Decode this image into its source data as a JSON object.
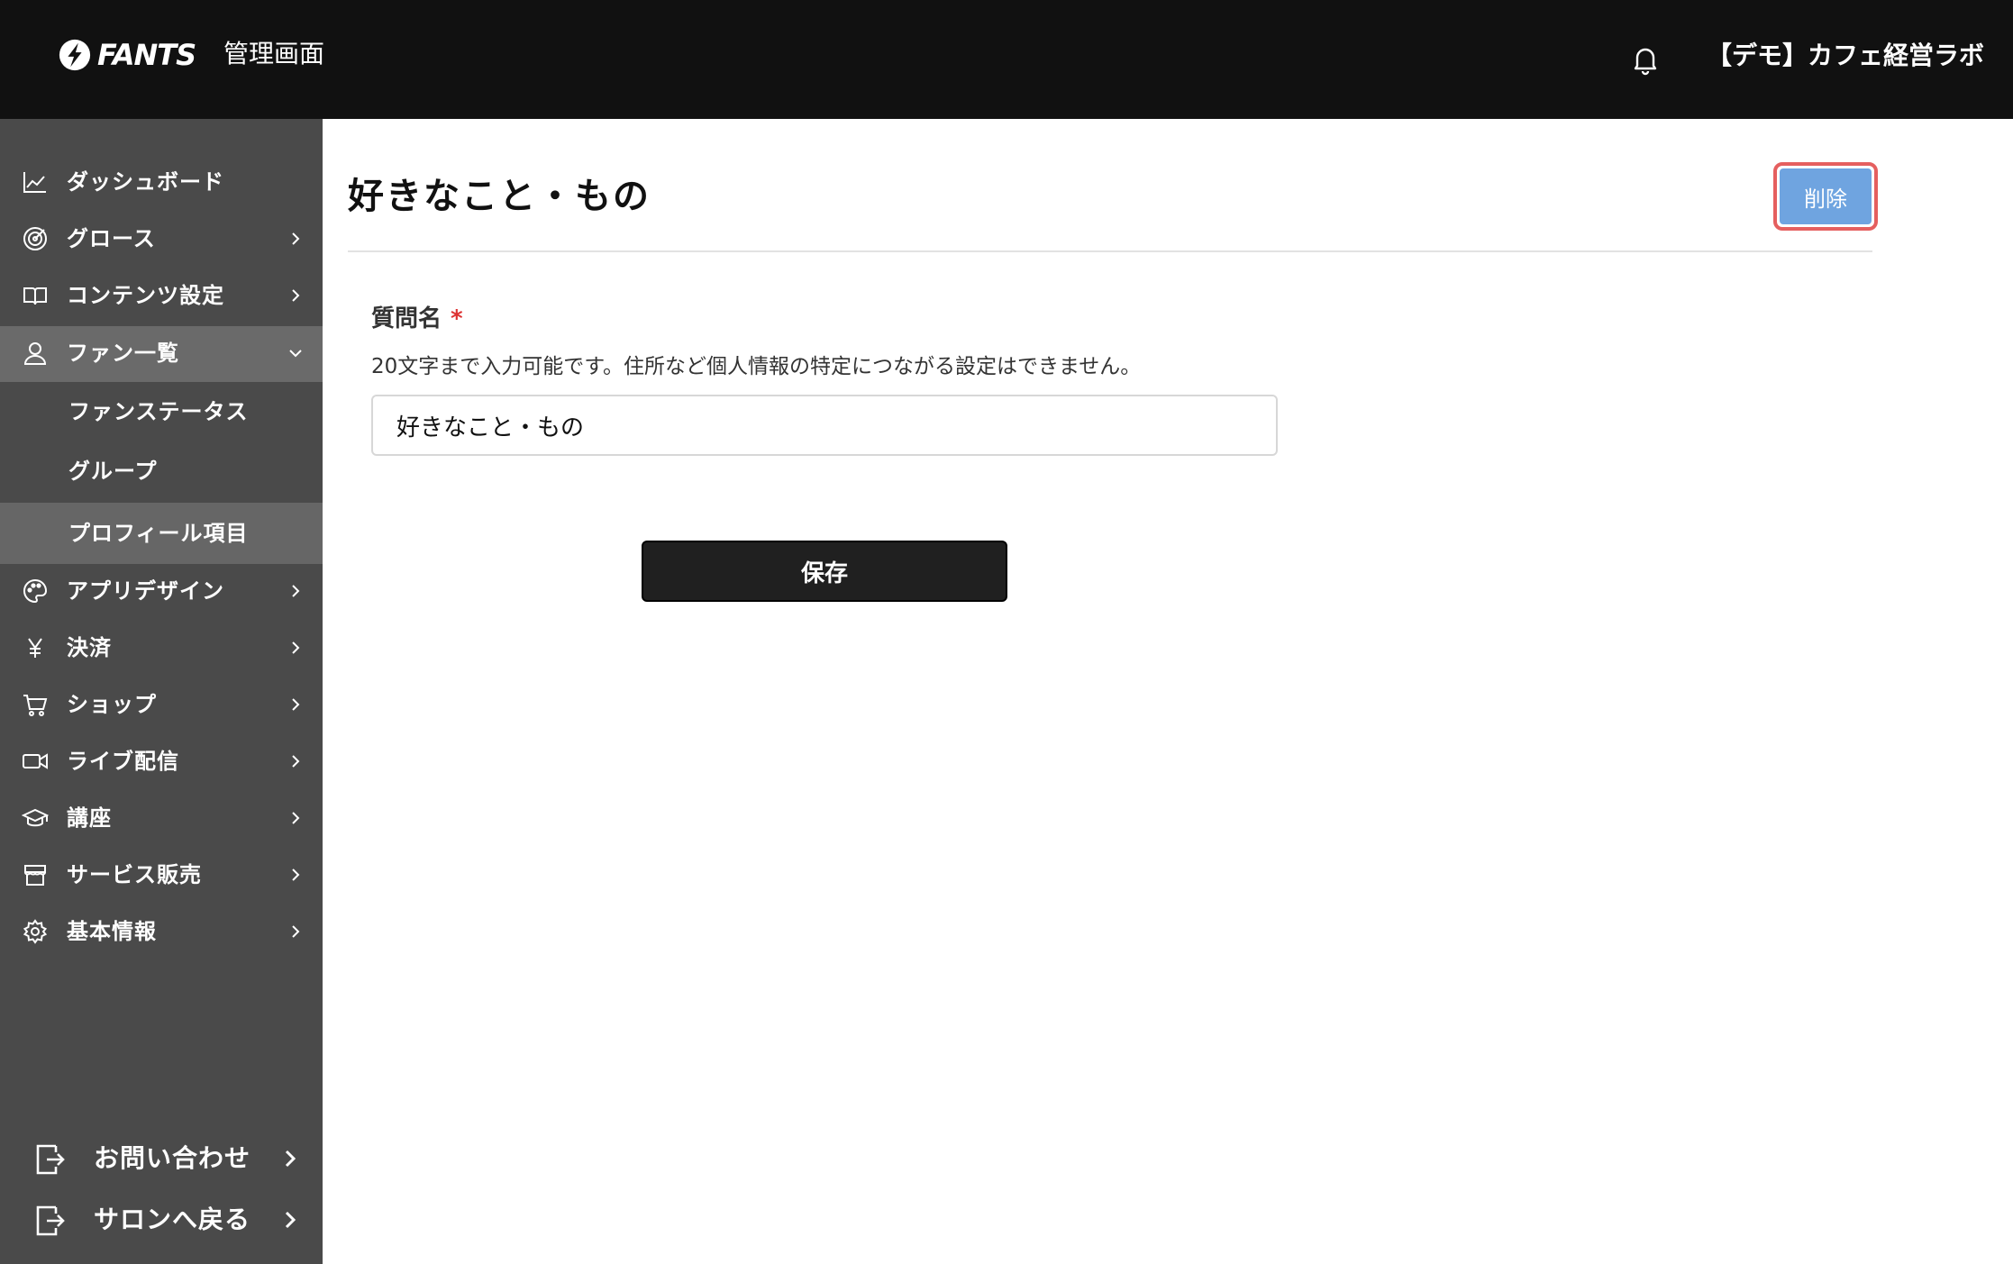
{
  "header": {
    "brand": "FANTS",
    "admin_title": "管理画面",
    "org_name": "【デモ】カフェ経営ラボ"
  },
  "sidebar": {
    "items": [
      {
        "label": "ダッシュボード",
        "icon": "chart-line-icon"
      },
      {
        "label": "グロース",
        "icon": "target-icon"
      },
      {
        "label": "コンテンツ設定",
        "icon": "book-icon"
      },
      {
        "label": "ファン一覧",
        "icon": "user-icon",
        "expanded": true
      },
      {
        "label": "アプリデザイン",
        "icon": "palette-icon"
      },
      {
        "label": "決済",
        "icon": "yen-icon"
      },
      {
        "label": "ショップ",
        "icon": "cart-icon"
      },
      {
        "label": "ライブ配信",
        "icon": "video-icon"
      },
      {
        "label": "講座",
        "icon": "graduation-cap-icon"
      },
      {
        "label": "サービス販売",
        "icon": "store-icon"
      },
      {
        "label": "基本情報",
        "icon": "gear-icon"
      }
    ],
    "sub_items": [
      {
        "label": "ファンステータス"
      },
      {
        "label": "グループ"
      },
      {
        "label": "プロフィール項目",
        "current": true
      }
    ],
    "footer": [
      {
        "label": "お問い合わせ",
        "icon": "exit-icon"
      },
      {
        "label": "サロンへ戻る",
        "icon": "exit-icon"
      }
    ]
  },
  "main": {
    "title": "好きなこと・もの",
    "delete_label": "削除",
    "field_label": "質問名",
    "required_mark": "*",
    "field_help": "20文字まで入力可能です。住所など個人情報の特定につながる設定はできません。",
    "field_value": "好きなこと・もの",
    "save_label": "保存"
  },
  "colors": {
    "header_bg": "#111111",
    "sidebar_bg": "#4a4a4a",
    "active_bg": "#6a6a6a",
    "delete_btn": "#6fa4e0",
    "delete_highlight": "#e55f5f",
    "save_btn": "#202020"
  }
}
